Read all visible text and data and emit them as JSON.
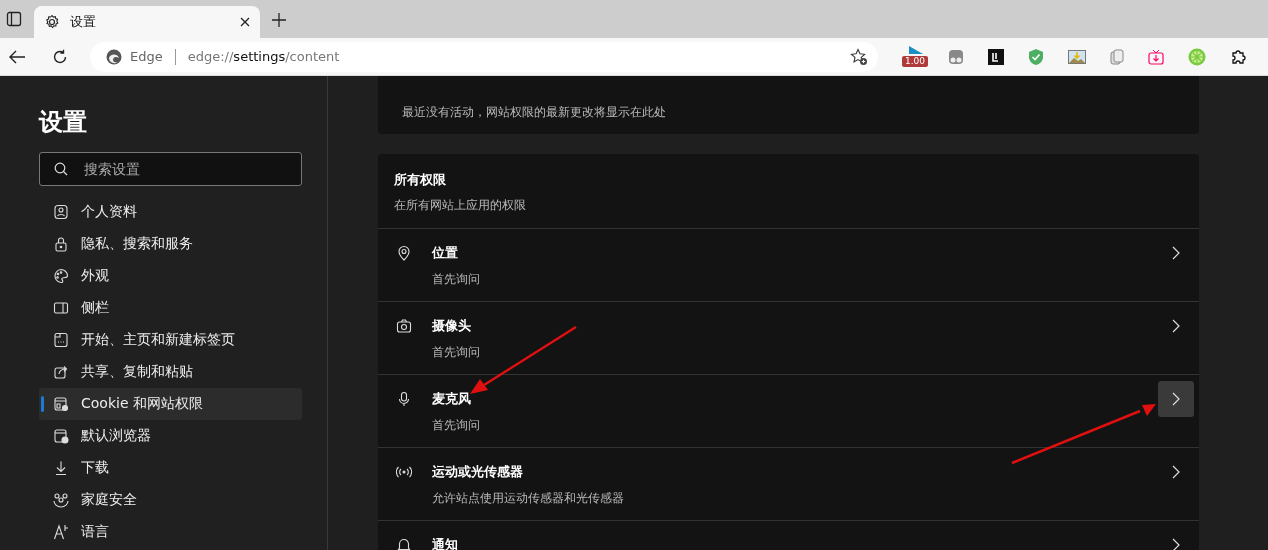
{
  "tab": {
    "title": "设置",
    "selected": true
  },
  "address_bar": {
    "site_label": "Edge",
    "url_scheme": "edge://",
    "url_host": "settings",
    "url_path": "/content"
  },
  "extensions": [
    {
      "kind": "rating",
      "badge": "1.00"
    },
    {
      "kind": "dual"
    },
    {
      "kind": "square"
    },
    {
      "kind": "shield"
    },
    {
      "kind": "image"
    },
    {
      "kind": "copy"
    },
    {
      "kind": "tv"
    },
    {
      "kind": "lime"
    },
    {
      "kind": "puzzle"
    }
  ],
  "sidebar": {
    "title": "设置",
    "search": {
      "placeholder": "搜索设置"
    },
    "items": [
      {
        "label": "个人资料",
        "selected": false
      },
      {
        "label": "隐私、搜索和服务",
        "selected": false
      },
      {
        "label": "外观",
        "selected": false
      },
      {
        "label": "侧栏",
        "selected": false
      },
      {
        "label": "开始、主页和新建标签页",
        "selected": false
      },
      {
        "label": "共享、复制和粘贴",
        "selected": false
      },
      {
        "label": "Cookie 和网站权限",
        "selected": true
      },
      {
        "label": "默认浏览器",
        "selected": false
      },
      {
        "label": "下载",
        "selected": false
      },
      {
        "label": "家庭安全",
        "selected": false
      },
      {
        "label": "语言",
        "selected": false
      }
    ]
  },
  "recent_activity": {
    "text": "最近没有活动，网站权限的最新更改将显示在此处"
  },
  "permissions": {
    "title": "所有权限",
    "subtitle": "在所有网站上应用的权限",
    "rows": [
      {
        "kind": "location",
        "label": "位置",
        "description": "首先询问",
        "highlighted": false
      },
      {
        "kind": "camera",
        "label": "摄像头",
        "description": "首先询问",
        "highlighted": false
      },
      {
        "kind": "microphone",
        "label": "麦克风",
        "description": "首先询问",
        "highlighted": true
      },
      {
        "kind": "sensors",
        "label": "运动或光传感器",
        "description": "允许站点使用运动传感器和光传感器",
        "highlighted": false
      },
      {
        "kind": "notification",
        "label": "通知",
        "description": "",
        "highlighted": false
      }
    ]
  }
}
